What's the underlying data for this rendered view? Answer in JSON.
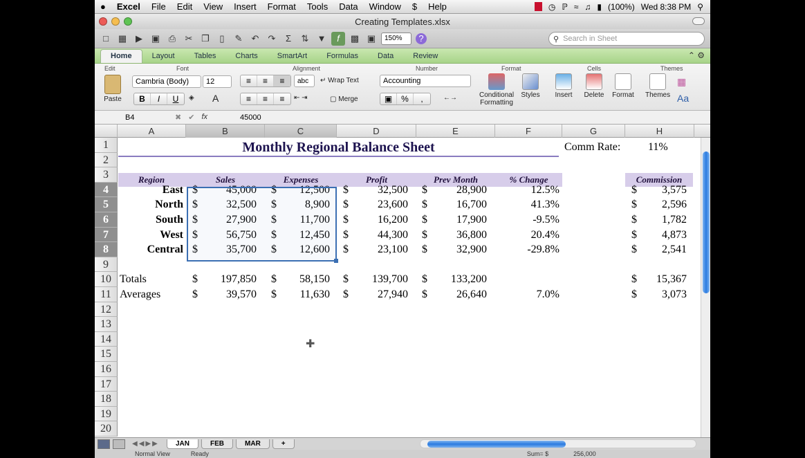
{
  "menubar": {
    "apple": "",
    "app": "Excel",
    "items": [
      "File",
      "Edit",
      "View",
      "Insert",
      "Format",
      "Tools",
      "Data",
      "Window",
      "$",
      "Help"
    ],
    "battery": "(100%)",
    "clock": "Wed 8:38 PM"
  },
  "window": {
    "title": "Creating Templates.xlsx"
  },
  "toolbar": {
    "zoom": "150%",
    "search_placeholder": "Search in Sheet"
  },
  "ribbon": {
    "tabs": [
      "Home",
      "Layout",
      "Tables",
      "Charts",
      "SmartArt",
      "Formulas",
      "Data",
      "Review"
    ],
    "groups": {
      "edit": "Edit",
      "font": "Font",
      "alignment": "Alignment",
      "number": "Number",
      "format": "Format",
      "cells": "Cells",
      "themes": "Themes"
    },
    "font_name": "Cambria (Body)",
    "font_size": "12",
    "wrap_text": "Wrap Text",
    "merge": "Merge",
    "number_format": "Accounting",
    "paste": "Paste",
    "conditional": "Conditional",
    "formatting": "Formatting",
    "styles": "Styles",
    "insert": "Insert",
    "delete": "Delete",
    "format_btn": "Format",
    "themes_btn": "Themes",
    "bold": "B",
    "italic": "I",
    "underline": "U",
    "abc": "abc",
    "percent": "%",
    "comma": ","
  },
  "formula_bar": {
    "cell_ref": "B4",
    "fx": "fx",
    "value": "45000"
  },
  "grid": {
    "columns": [
      "A",
      "B",
      "C",
      "D",
      "E",
      "F",
      "G",
      "H"
    ],
    "rows": [
      "1",
      "2",
      "3",
      "4",
      "5",
      "6",
      "7",
      "8",
      "9",
      "10",
      "11",
      "12",
      "13",
      "14",
      "15",
      "16",
      "17",
      "18",
      "19",
      "20"
    ],
    "title": "Monthly Regional Balance Sheet",
    "comm_rate_label": "Comm Rate:",
    "comm_rate_value": "11%",
    "headers": {
      "region": "Region",
      "sales": "Sales",
      "expenses": "Expenses",
      "profit": "Profit",
      "prev": "Prev Month",
      "change": "% Change",
      "commission": "Commission"
    },
    "currency": "$",
    "data": [
      {
        "region": "East",
        "sales": "45,000",
        "expenses": "12,500",
        "profit": "32,500",
        "prev": "28,900",
        "change": "12.5%",
        "commission": "3,575"
      },
      {
        "region": "North",
        "sales": "32,500",
        "expenses": "8,900",
        "profit": "23,600",
        "prev": "16,700",
        "change": "41.3%",
        "commission": "2,596"
      },
      {
        "region": "South",
        "sales": "27,900",
        "expenses": "11,700",
        "profit": "16,200",
        "prev": "17,900",
        "change": "-9.5%",
        "commission": "1,782"
      },
      {
        "region": "West",
        "sales": "56,750",
        "expenses": "12,450",
        "profit": "44,300",
        "prev": "36,800",
        "change": "20.4%",
        "commission": "4,873"
      },
      {
        "region": "Central",
        "sales": "35,700",
        "expenses": "12,600",
        "profit": "23,100",
        "prev": "32,900",
        "change": "-29.8%",
        "commission": "2,541"
      }
    ],
    "totals": {
      "label": "Totals",
      "sales": "197,850",
      "expenses": "58,150",
      "profit": "139,700",
      "prev": "133,200",
      "commission": "15,367"
    },
    "averages": {
      "label": "Averages",
      "sales": "39,570",
      "expenses": "11,630",
      "profit": "27,940",
      "prev": "26,640",
      "change": "7.0%",
      "commission": "3,073"
    }
  },
  "sheets": {
    "tabs": [
      "JAN",
      "FEB",
      "MAR"
    ],
    "active": "JAN",
    "add": "+"
  },
  "status": {
    "view": "Normal View",
    "state": "Ready",
    "sum_label": "Sum= $",
    "sum_value": "256,000"
  }
}
